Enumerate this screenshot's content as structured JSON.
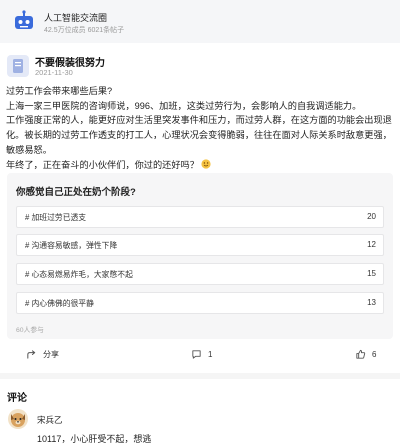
{
  "group": {
    "name": "人工智能交流圈",
    "meta": "42.5万位成员 6021条帖子",
    "icon": "robot-icon",
    "accent": "#3a6bdb"
  },
  "post": {
    "author": "不要假装很努力",
    "date": "2021-11-30",
    "lines": [
      "过劳工作会带来哪些后果?",
      "上海一家三甲医院的咨询师说，996、加班，这类过劳行为，会影响人的自我调适能力。",
      "工作强度正常的人，能更好应对生活里突发事件和压力，而过劳人群，在这方面的功能会出现退化。被长期的过劳工作透支的打工人，心理状况会变得脆弱，往往在面对人际关系时敌意更强，敏感易怒。",
      "年终了，正在奋斗的小伙伴们，你过的还好吗？"
    ],
    "emoji": "smile-emoji-icon"
  },
  "poll": {
    "question": "你感觉自己正处在奶个阶段?",
    "options": [
      {
        "label": "# 加班过劳已透支",
        "count": "20"
      },
      {
        "label": "# 沟通容易敏感，弹性下降",
        "count": "12"
      },
      {
        "label": "# 心态易燃易炸毛，大家憋不起",
        "count": "15"
      },
      {
        "label": "# 内心佛佛的很平静",
        "count": "13"
      }
    ],
    "participants": "60人参与"
  },
  "actions": {
    "share": "分享",
    "comments": "1",
    "likes": "6"
  },
  "comments": {
    "title": "评论",
    "items": [
      {
        "author": "宋兵乙",
        "text": "10117，小心肝受不起，想逃"
      }
    ]
  }
}
